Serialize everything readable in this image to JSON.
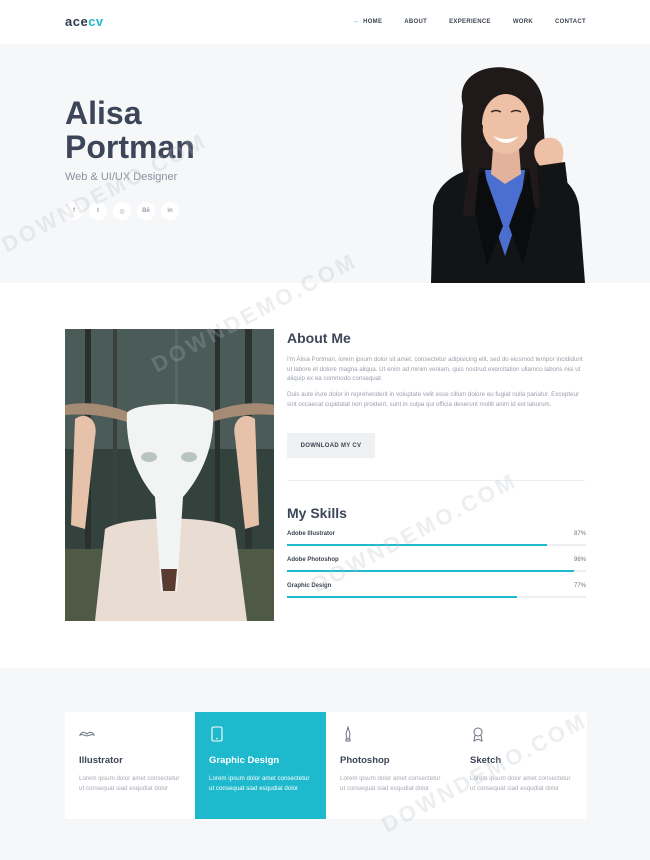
{
  "brand": {
    "logo_main": "ace",
    "logo_accent": "cv"
  },
  "nav": {
    "items": [
      {
        "label": "HOME"
      },
      {
        "label": "ABOUT"
      },
      {
        "label": "EXPERIENCE"
      },
      {
        "label": "WORK"
      },
      {
        "label": "CONTACT"
      }
    ]
  },
  "hero": {
    "first_name": "Alisa",
    "last_name": "Portman",
    "role": "Web & UI/UX Designer",
    "social": [
      "f",
      "t",
      "◎",
      "Bē",
      "in"
    ]
  },
  "about": {
    "title": "About Me",
    "paragraph1": "I'm Alisa Portman, lorem ipsum dolor sit amet, consectetur adipisicing elit, sed do eiusmod tempor incididunt ut labore et dolore magna aliqua. Ut enim ad minim veniam, quis nostrud exercitation ullamco laboris nisi ut aliquip ex ea commodo consequat.",
    "paragraph2": "Duis aute irure dolor in reprehenderit in voluptate velit esse cillum dolore eu fugiat nulla pariatur. Excepteur sint occaecat cupidatat non proident, sunt in culpa qui officia deserunt mollit anim id est laborum.",
    "download_label": "DOWNLOAD MY CV"
  },
  "skills": {
    "title": "My Skills",
    "items": [
      {
        "name": "Adobe Illustrator",
        "percent_label": "87%",
        "value": 87
      },
      {
        "name": "Adobe Photoshop",
        "percent_label": "96%",
        "value": 96
      },
      {
        "name": "Graphic Design",
        "percent_label": "77%",
        "value": 77
      }
    ]
  },
  "services": [
    {
      "title": "Illustrator",
      "desc": "Lorem ipsum dolor amet consectetur ut consequat siad esqudiat dolor",
      "icon": "mustache-icon",
      "active": false
    },
    {
      "title": "Graphic Design",
      "desc": "Lorem ipsum dolor amet consectetur ut consequat siad esqudiat dolor",
      "icon": "tablet-icon",
      "active": true
    },
    {
      "title": "Photoshop",
      "desc": "Lorem ipsum dolor amet consectetur ut consequat siad esqudiat dolor",
      "icon": "pen-tool-icon",
      "active": false
    },
    {
      "title": "Sketch",
      "desc": "Lorem ipsum dolor amet consectetur ut consequat siad esqudiat dolor",
      "icon": "user-badge-icon",
      "active": false
    }
  ],
  "watermark": "DOWNDEMO.COM",
  "colors": {
    "accent": "#20b8cb",
    "heading": "#3d4659",
    "muted": "#9aa1ab",
    "light_bg": "#f6f7f9"
  }
}
